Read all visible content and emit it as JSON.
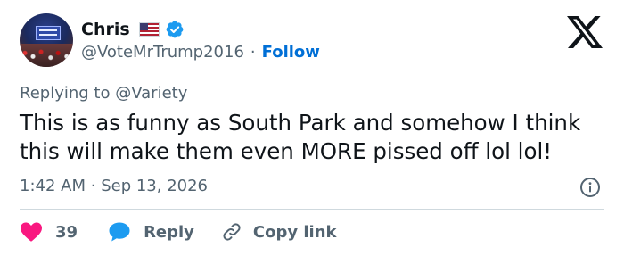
{
  "author": {
    "name": "Chris",
    "handle": "@VoteMrTrump2016",
    "separator": "·",
    "follow_label": "Follow",
    "flag_icon": "us-flag-icon",
    "verified_color": "#1d9bf0"
  },
  "reply_context": {
    "prefix": "Replying to",
    "target": "@Variety"
  },
  "tweet": {
    "text": "This is as funny as South Park and somehow I think this will make them even MORE pissed off lol lol!"
  },
  "meta": {
    "time": "1:42 AM",
    "separator": "·",
    "date": "Sep 13, 2026"
  },
  "actions": {
    "like_count": "39",
    "reply_label": "Reply",
    "copy_link_label": "Copy link"
  },
  "colors": {
    "text": "#0f1419",
    "secondary": "#536471",
    "link": "#006fd6",
    "like": "#f91880",
    "reply": "#1d9bf0",
    "divider": "#cfd9de"
  }
}
